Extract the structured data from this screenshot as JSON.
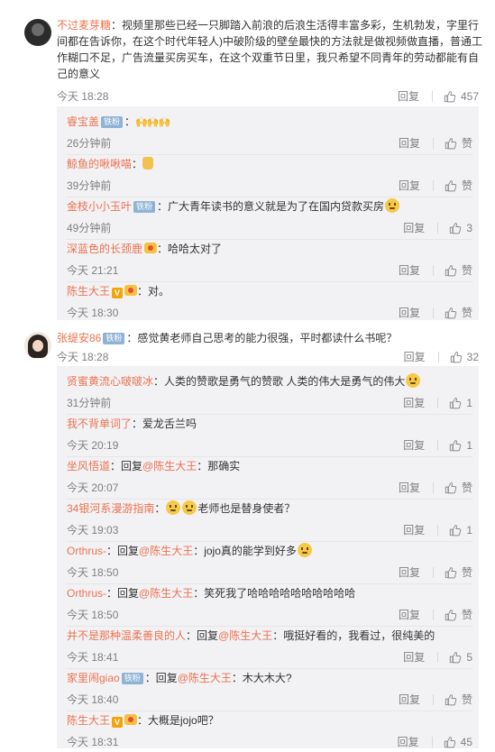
{
  "thread1": {
    "user": "不过麦芽糖",
    "text_lines": [
      "视频里那些已经一只脚踏入前浪的后浪生活得丰富多彩，生机勃发，字里行",
      "间都在告诉你，在这个时代年轻人)中破阶级的壁垒最快的方法就是做视频做直播，普通工",
      "作糊口不足，广告流量买房买车，在这个双重节日里，我只希望不同青年的劳动都能有自",
      "己的意义"
    ],
    "time": "今天 18:28",
    "reply_label": "回复",
    "like_count": "457",
    "replies": [
      {
        "user": "睿宝盖",
        "badge": "铁粉",
        "text": "：",
        "time": "26分钟前",
        "like": "赞"
      },
      {
        "user": "鲸鱼的啾啾喵",
        "text": "：",
        "time": "39分钟前",
        "like": "赞"
      },
      {
        "user": "金枝小小玉叶",
        "badge": "铁粉",
        "text": "：广大青年读书的意义就是为了在国内贷款买房",
        "time": "49分钟前",
        "like": "3"
      },
      {
        "user": "深蓝色的长颈鹿",
        "text": "：哈哈太对了",
        "time": "今天 21:21",
        "like": "赞"
      },
      {
        "user": "陈生大王",
        "vip": "V",
        "text": "：对。",
        "time": "今天 18:30",
        "like": "赞"
      }
    ]
  },
  "thread2": {
    "user": "张缇安86",
    "badge": "铁粉",
    "text": "：感觉黄老师自己思考的能力很强，平时都读什么书呢？",
    "time": "今天 18:28",
    "reply_label": "回复",
    "like_count": "32",
    "replies": [
      {
        "user": "贤蜜黄流心啵啵冰",
        "text": "：人类的赞歌是勇气的赞歌 人类的伟大是勇气的伟大",
        "time": "31分钟前",
        "like": "1"
      },
      {
        "user": "我不背单词了",
        "text": "：爱龙舌兰吗",
        "time": "今天 20:19",
        "like": "1"
      },
      {
        "user": "坐风悟道",
        "reply_prefix": "：回复",
        "mention": "@陈生大王",
        "text": "：那确实",
        "time": "今天 20:07",
        "like": "赞"
      },
      {
        "user": "34银河系漫游指南",
        "text": "：",
        "text_after": "老师也是替身使者？",
        "time": "今天 19:03",
        "like": "1"
      },
      {
        "user": "Orthrus-",
        "reply_prefix": "：回复",
        "mention": "@陈生大王",
        "text": "：jojo真的能学到好多",
        "time": "今天 18:50",
        "like": "赞"
      },
      {
        "user": "Orthrus-",
        "reply_prefix": "：回复",
        "mention": "@陈生大王",
        "text": "：笑死我了哈哈哈哈哈哈哈哈哈哈",
        "time": "今天 18:50",
        "like": "赞"
      },
      {
        "user": "并不是那种温柔善良的人",
        "reply_prefix": "：回复",
        "mention": "@陈生大王",
        "text": "：哦挺好看的，我看过，很纯美的",
        "time": "今天 18:41",
        "like": "5"
      },
      {
        "user": "家里闹giao",
        "badge": "铁粉",
        "reply_prefix": "：回复",
        "mention": "@陈生大王",
        "text": "：木大木大?",
        "time": "今天 18:40",
        "like": "赞"
      },
      {
        "user": "陈生大王",
        "vip": "V",
        "text": "：大概是jojo吧？",
        "time": "今天 18:31",
        "like": "45"
      }
    ]
  },
  "colors": {
    "username": "#eb7350",
    "meta": "#808080",
    "subbox": "#f2f2f5",
    "badge": "#8fb3d4"
  },
  "icons": {
    "like": "thumbs-up-icon",
    "avatar1": "avatar",
    "avatar2": "avatar"
  }
}
